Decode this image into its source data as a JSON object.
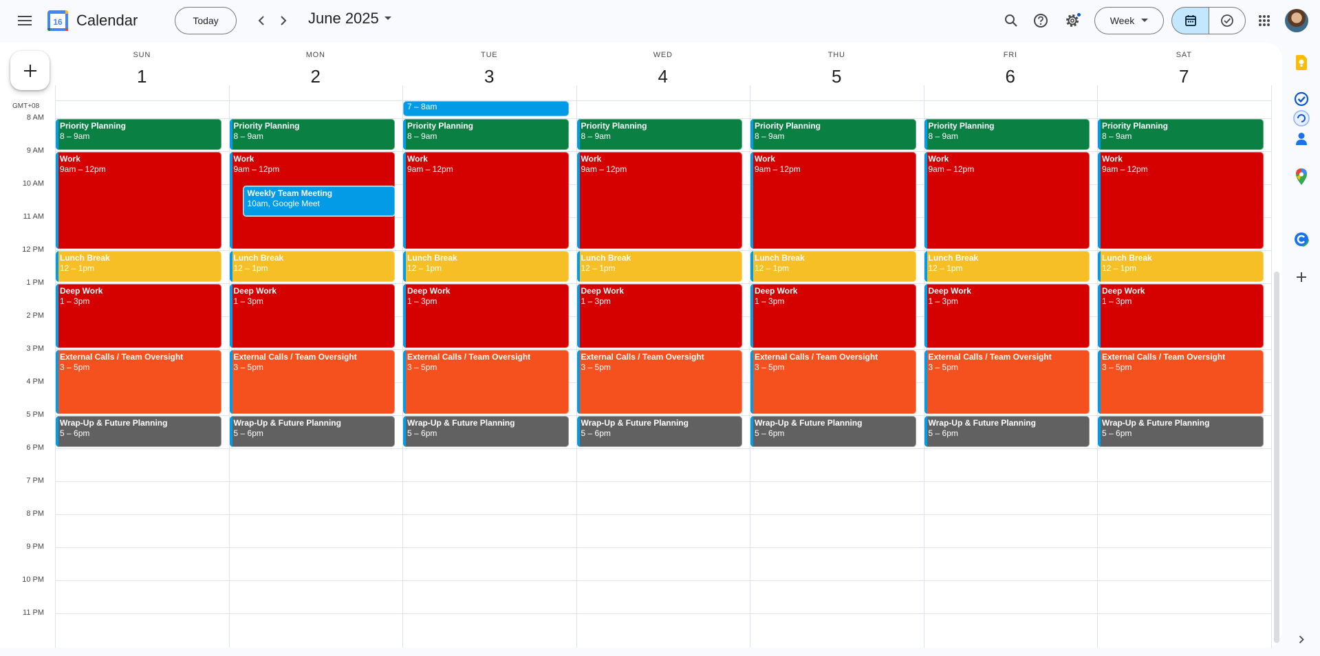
{
  "app": {
    "title": "Calendar",
    "logo_day": "16"
  },
  "toolbar": {
    "today_label": "Today",
    "month_label": "June 2025",
    "view_label": "Week"
  },
  "timezone": "GMT+08",
  "days": [
    {
      "name": "SUN",
      "num": "1"
    },
    {
      "name": "MON",
      "num": "2"
    },
    {
      "name": "TUE",
      "num": "3"
    },
    {
      "name": "WED",
      "num": "4"
    },
    {
      "name": "THU",
      "num": "5"
    },
    {
      "name": "FRI",
      "num": "6"
    },
    {
      "name": "SAT",
      "num": "7"
    }
  ],
  "hours": [
    "8 AM",
    "9 AM",
    "10 AM",
    "11 AM",
    "12 PM",
    "1 PM",
    "2 PM",
    "3 PM",
    "4 PM",
    "5 PM",
    "6 PM",
    "7 PM",
    "8 PM",
    "9 PM",
    "10 PM",
    "11 PM"
  ],
  "daily_events": [
    {
      "title": "Priority Planning",
      "time": "8 – 9am",
      "start": 8,
      "end": 9,
      "color": "#0b8043"
    },
    {
      "title": "Work",
      "time": "9am – 12pm",
      "start": 9,
      "end": 12,
      "color": "#d50000"
    },
    {
      "title": "Lunch Break",
      "time": "12 – 1pm",
      "start": 12,
      "end": 13,
      "color": "#f6bf26"
    },
    {
      "title": "Deep Work",
      "time": "1 – 3pm",
      "start": 13,
      "end": 15,
      "color": "#d50000"
    },
    {
      "title": "External Calls / Team Oversight",
      "time": "3 – 5pm",
      "start": 15,
      "end": 17,
      "color": "#f4511e"
    },
    {
      "title": "Wrap-Up & Future Planning",
      "time": "5 – 6pm",
      "start": 17,
      "end": 18,
      "color": "#616161"
    }
  ],
  "extra_events": [
    {
      "day": 2,
      "title": "Weekly Team Meeting",
      "time": "10am, Google Meet",
      "color": "#039be5"
    },
    {
      "day": 3,
      "title": "",
      "time": "7 – 8am",
      "color": "#039be5"
    }
  ],
  "icons": [
    "menu-icon",
    "search-icon",
    "help-icon",
    "settings-icon",
    "calendar-icon",
    "check-circle-icon",
    "apps-grid-icon",
    "keep-icon",
    "tasks-icon",
    "contacts-icon",
    "maps-icon",
    "plus-icon"
  ]
}
